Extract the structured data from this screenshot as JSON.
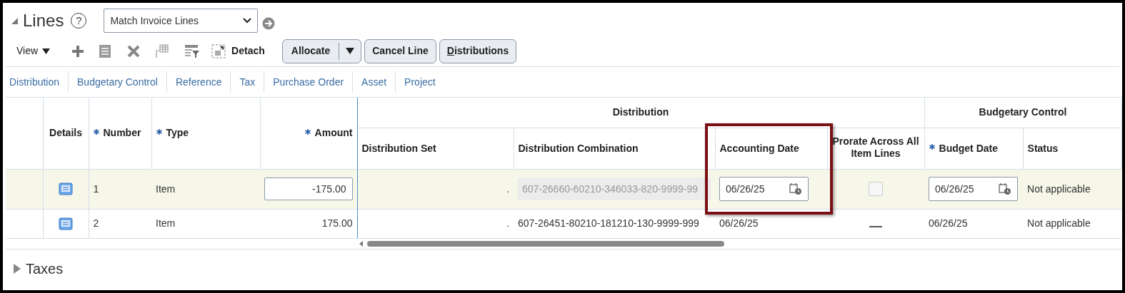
{
  "section": {
    "title": "Lines",
    "expanded": true,
    "help": "?",
    "view_select": {
      "value": "Match Invoice Lines"
    }
  },
  "toolbar": {
    "view_menu": "View",
    "detach": "Detach",
    "buttons": [
      {
        "label": "Allocate",
        "kind": "split",
        "mnemonic": false
      },
      {
        "label": "Cancel Line",
        "kind": "plain",
        "mnemonic": false
      },
      {
        "label": "Distributions",
        "kind": "plain",
        "mnemonic": true
      }
    ]
  },
  "links": [
    "Distribution",
    "Budgetary Control",
    "Reference",
    "Tax",
    "Purchase Order",
    "Asset",
    "Project"
  ],
  "table": {
    "columns": [
      {
        "label": "Details",
        "required": false
      },
      {
        "label": "Number",
        "required": true
      },
      {
        "label": "Type",
        "required": true
      },
      {
        "label": "Amount",
        "required": true
      }
    ],
    "groups": [
      {
        "label": "Distribution",
        "columns": [
          {
            "label": "Distribution Set",
            "required": false,
            "highlighted": false
          },
          {
            "label": "Distribution Combination",
            "required": false,
            "highlighted": false
          },
          {
            "label": "Accounting Date",
            "required": false,
            "highlighted": true
          },
          {
            "label": "Prorate Across All Item Lines",
            "required": false,
            "highlighted": false
          }
        ]
      },
      {
        "label": "Budgetary Control",
        "columns": [
          {
            "label": "Budget Date",
            "required": true,
            "highlighted": false
          },
          {
            "label": "Status",
            "required": false,
            "highlighted": false
          }
        ]
      }
    ],
    "rows": [
      {
        "selected": true,
        "cells": [
          {
            "kind": "icon"
          },
          {
            "kind": "text",
            "value": "1"
          },
          {
            "kind": "text",
            "value": "Item"
          },
          {
            "kind": "input",
            "value": "-175.00"
          },
          {
            "kind": "dot",
            "value": "."
          },
          {
            "kind": "readonly",
            "value": "607-26660-60210-346033-820-9999-99"
          },
          {
            "kind": "date",
            "value": "06/26/25"
          },
          {
            "kind": "checkbox",
            "checked": false
          },
          {
            "kind": "date",
            "value": "06/26/25"
          },
          {
            "kind": "text",
            "value": "Not applicable"
          }
        ]
      },
      {
        "selected": false,
        "cells": [
          {
            "kind": "icon"
          },
          {
            "kind": "text",
            "value": "2"
          },
          {
            "kind": "text",
            "value": "Item"
          },
          {
            "kind": "number",
            "value": "175.00"
          },
          {
            "kind": "dot",
            "value": "."
          },
          {
            "kind": "text",
            "value": "607-26451-80210-181210-130-9999-999"
          },
          {
            "kind": "text",
            "value": "06/26/25"
          },
          {
            "kind": "dash"
          },
          {
            "kind": "text",
            "value": "06/26/25"
          },
          {
            "kind": "text",
            "value": "Not applicable"
          }
        ]
      }
    ]
  },
  "taxes": {
    "title": "Taxes",
    "expanded": false
  }
}
